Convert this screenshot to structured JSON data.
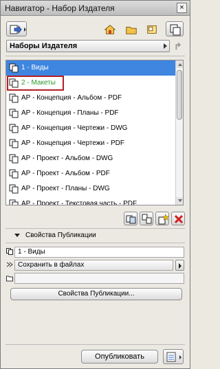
{
  "window": {
    "title": "Навигатор - Набор Издателя",
    "close_glyph": "×"
  },
  "toolbar": {
    "icons": [
      "publish-arrow-icon",
      "house-icon",
      "folder-icon",
      "layout-icon",
      "publisher-set-icon"
    ]
  },
  "set_selector": {
    "selected": "Наборы Издателя"
  },
  "items": [
    {
      "label": "1 - Виды",
      "state": "selected"
    },
    {
      "label": "2 - Макеты",
      "state": "highlighted"
    },
    {
      "label": "АР - Концепция - Альбом  - PDF",
      "state": "normal"
    },
    {
      "label": "АР - Концепция - Планы - PDF",
      "state": "normal"
    },
    {
      "label": "АР - Концепция - Чертежи - DWG",
      "state": "normal"
    },
    {
      "label": "АР - Концепция - Чертежи - PDF",
      "state": "normal"
    },
    {
      "label": "АР - Проект - Альбом - DWG",
      "state": "normal"
    },
    {
      "label": "АР - Проект - Альбом - PDF",
      "state": "normal"
    },
    {
      "label": "АР - Проект - Планы - DWG",
      "state": "normal"
    },
    {
      "label": "АР - Проект - Текстовая часть - PDF",
      "state": "normal"
    }
  ],
  "properties": {
    "header": "Свойства Публикации",
    "name_value": "1 - Виды",
    "output_mode": "Сохранить в файлах",
    "path_value": "",
    "properties_button": "Свойства Публикации..."
  },
  "footer": {
    "publish_button": "Опубликовать"
  },
  "colors": {
    "selected_row": "#3e86e0",
    "highlight_border": "#b51f24",
    "green_text": "#2f9a2f"
  }
}
